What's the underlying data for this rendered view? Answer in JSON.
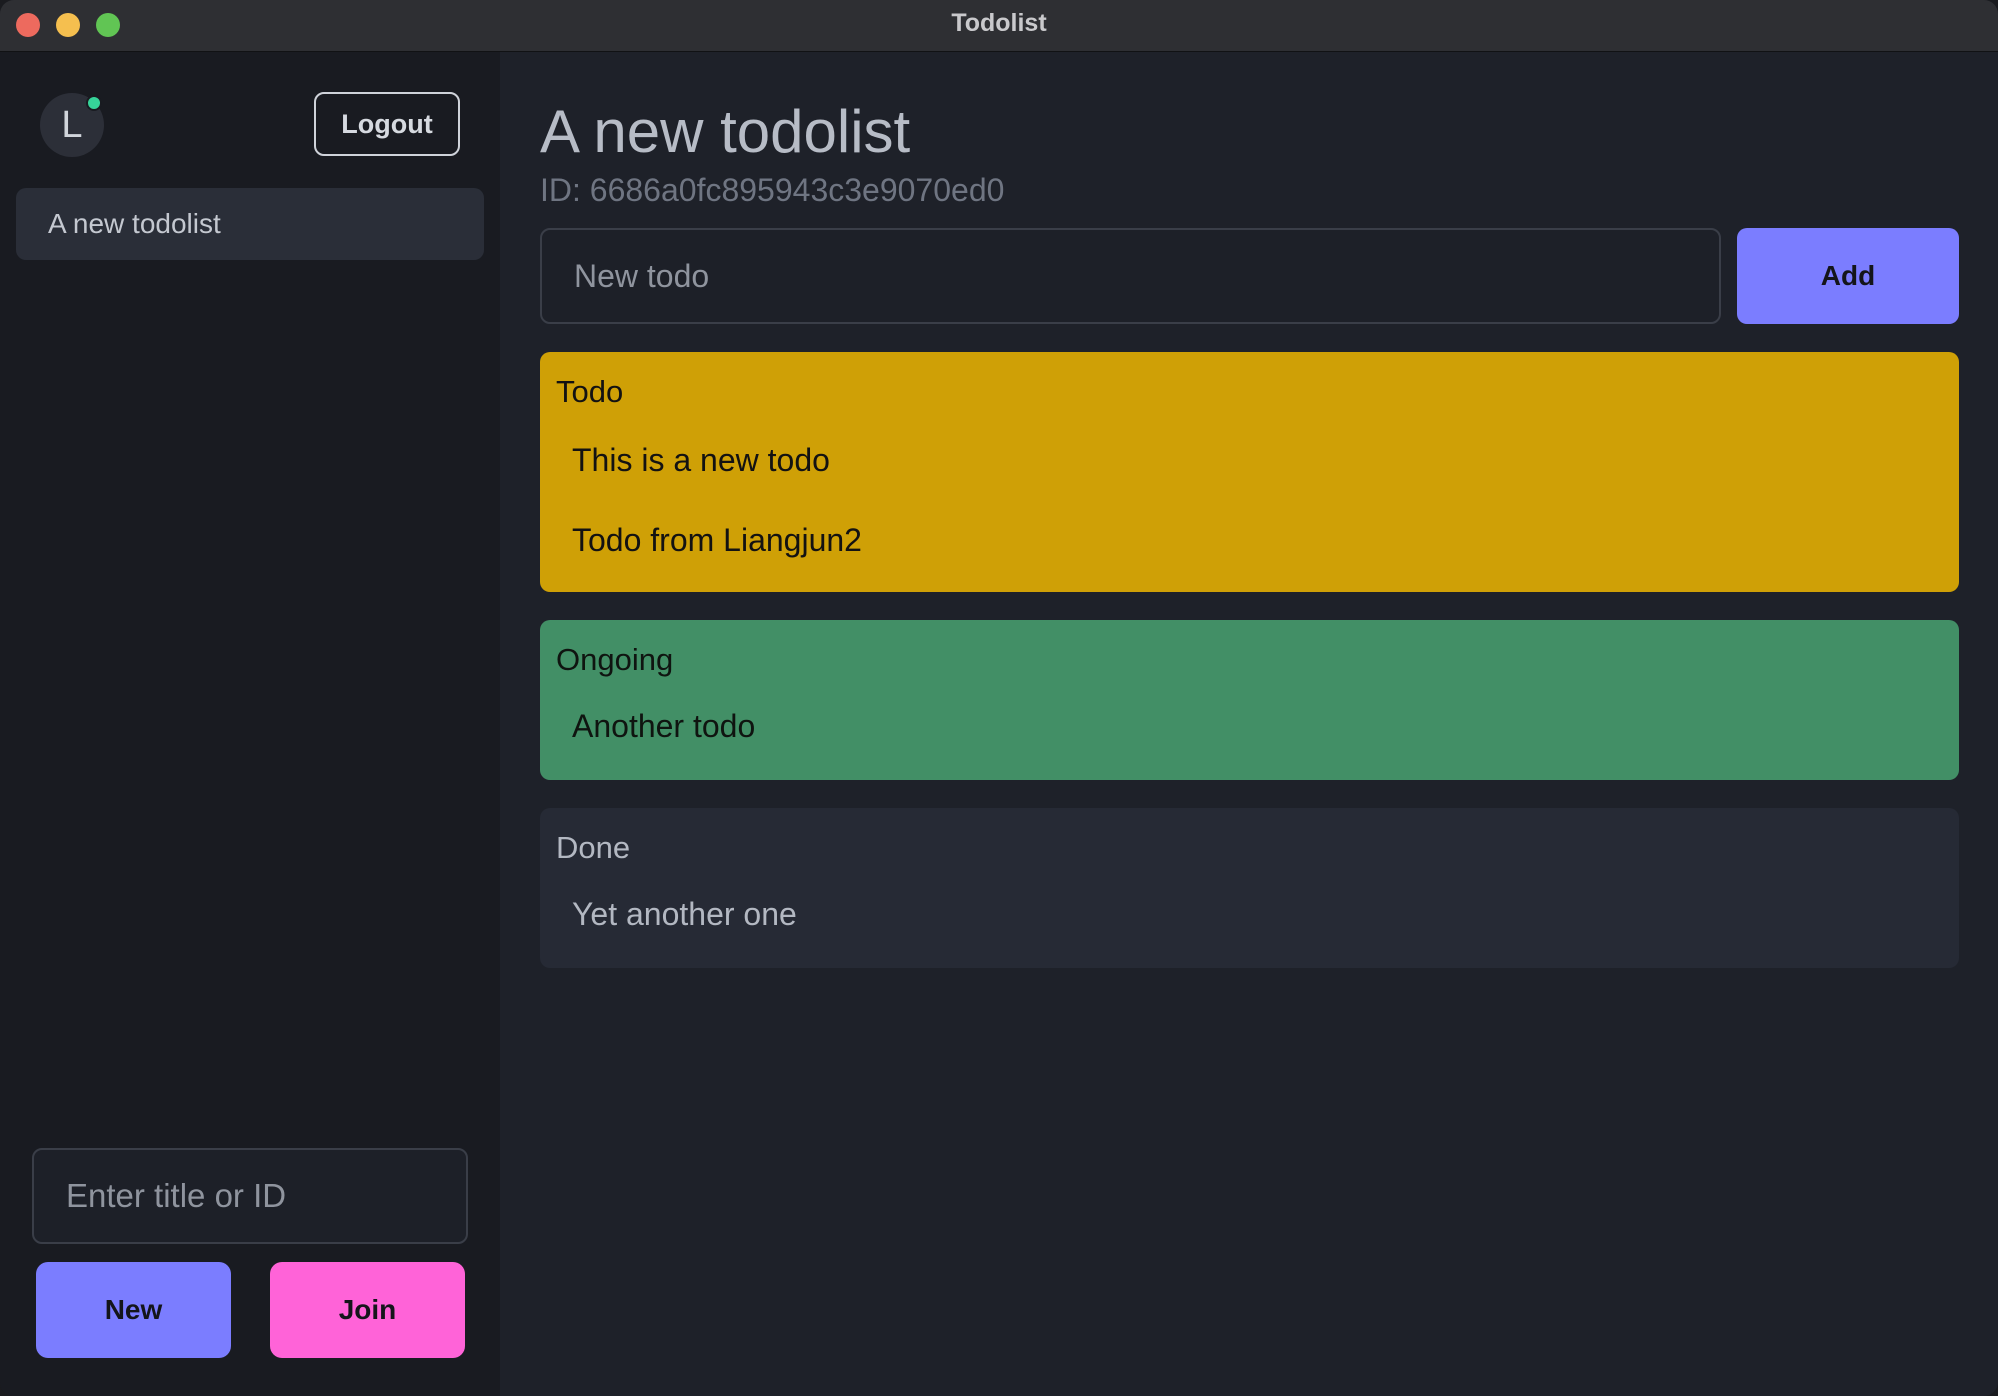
{
  "window": {
    "title": "Todolist"
  },
  "sidebar": {
    "avatar_initial": "L",
    "logout_label": "Logout",
    "lists": [
      {
        "label": "A new todolist"
      }
    ],
    "title_input_placeholder": "Enter title or ID",
    "new_label": "New",
    "join_label": "Join"
  },
  "main": {
    "title": "A new todolist",
    "id_text": "ID: 6686a0fc895943c3e9070ed0",
    "todo_input_placeholder": "New todo",
    "add_label": "Add",
    "groups": [
      {
        "title": "Todo",
        "color": "#cfa006",
        "items": [
          "This is a new todo",
          "Todo from Liangjun2"
        ]
      },
      {
        "title": "Ongoing",
        "color": "#428f66",
        "items": [
          "Another todo"
        ]
      },
      {
        "title": "Done",
        "color": "#262a35",
        "items": [
          "Yet another one"
        ]
      }
    ]
  },
  "colors": {
    "accent": "#7b7dff",
    "join": "#ff63d8",
    "online": "#36d399"
  },
  "icons": {
    "close": "close-icon",
    "minimize": "minimize-icon",
    "maximize": "maximize-icon",
    "online": "online-status-icon"
  }
}
